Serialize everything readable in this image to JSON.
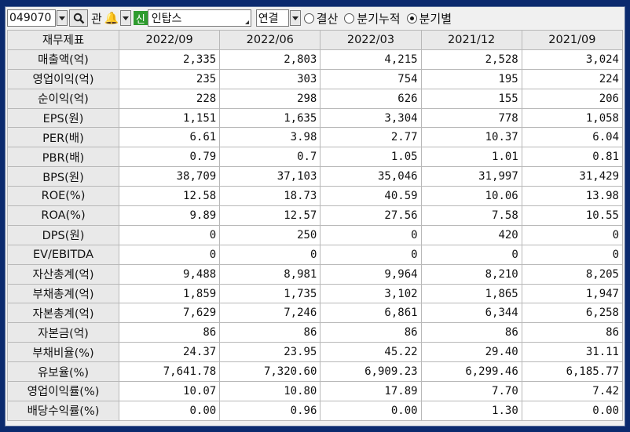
{
  "toolbar": {
    "code": "049070",
    "gwan_label": "관",
    "shin_badge": "신",
    "stock_name": "인탑스",
    "consolidation": "연결",
    "radio_settlement": "결산",
    "radio_quarter_cumulative": "분기누적",
    "radio_quarterly": "분기별",
    "selected_radio": "분기별"
  },
  "table": {
    "header_label": "재무제표",
    "periods": [
      "2022/09",
      "2022/06",
      "2022/03",
      "2021/12",
      "2021/09"
    ],
    "rows": [
      {
        "label": "매출액(억)",
        "values": [
          "2,335",
          "2,803",
          "4,215",
          "2,528",
          "3,024"
        ]
      },
      {
        "label": "영업이익(억)",
        "values": [
          "235",
          "303",
          "754",
          "195",
          "224"
        ]
      },
      {
        "label": "순이익(억)",
        "values": [
          "228",
          "298",
          "626",
          "155",
          "206"
        ]
      },
      {
        "label": "EPS(원)",
        "values": [
          "1,151",
          "1,635",
          "3,304",
          "778",
          "1,058"
        ]
      },
      {
        "label": "PER(배)",
        "values": [
          "6.61",
          "3.98",
          "2.77",
          "10.37",
          "6.04"
        ]
      },
      {
        "label": "PBR(배)",
        "values": [
          "0.79",
          "0.7",
          "1.05",
          "1.01",
          "0.81"
        ]
      },
      {
        "label": "BPS(원)",
        "values": [
          "38,709",
          "37,103",
          "35,046",
          "31,997",
          "31,429"
        ]
      },
      {
        "label": "ROE(%)",
        "values": [
          "12.58",
          "18.73",
          "40.59",
          "10.06",
          "13.98"
        ]
      },
      {
        "label": "ROA(%)",
        "values": [
          "9.89",
          "12.57",
          "27.56",
          "7.58",
          "10.55"
        ]
      },
      {
        "label": "DPS(원)",
        "values": [
          "0",
          "250",
          "0",
          "420",
          "0"
        ]
      },
      {
        "label": "EV/EBITDA",
        "values": [
          "0",
          "0",
          "0",
          "0",
          "0"
        ]
      },
      {
        "label": "자산총계(억)",
        "values": [
          "9,488",
          "8,981",
          "9,964",
          "8,210",
          "8,205"
        ]
      },
      {
        "label": "부채총계(억)",
        "values": [
          "1,859",
          "1,735",
          "3,102",
          "1,865",
          "1,947"
        ]
      },
      {
        "label": "자본총계(억)",
        "values": [
          "7,629",
          "7,246",
          "6,861",
          "6,344",
          "6,258"
        ]
      },
      {
        "label": "자본금(억)",
        "values": [
          "86",
          "86",
          "86",
          "86",
          "86"
        ]
      },
      {
        "label": "부채비율(%)",
        "values": [
          "24.37",
          "23.95",
          "45.22",
          "29.40",
          "31.11"
        ]
      },
      {
        "label": "유보율(%)",
        "values": [
          "7,641.78",
          "7,320.60",
          "6,909.23",
          "6,299.46",
          "6,185.77"
        ]
      },
      {
        "label": "영업이익률(%)",
        "values": [
          "10.07",
          "10.80",
          "17.89",
          "7.70",
          "7.42"
        ]
      },
      {
        "label": "배당수익률(%)",
        "values": [
          "0.00",
          "0.96",
          "0.00",
          "1.30",
          "0.00"
        ]
      }
    ]
  }
}
